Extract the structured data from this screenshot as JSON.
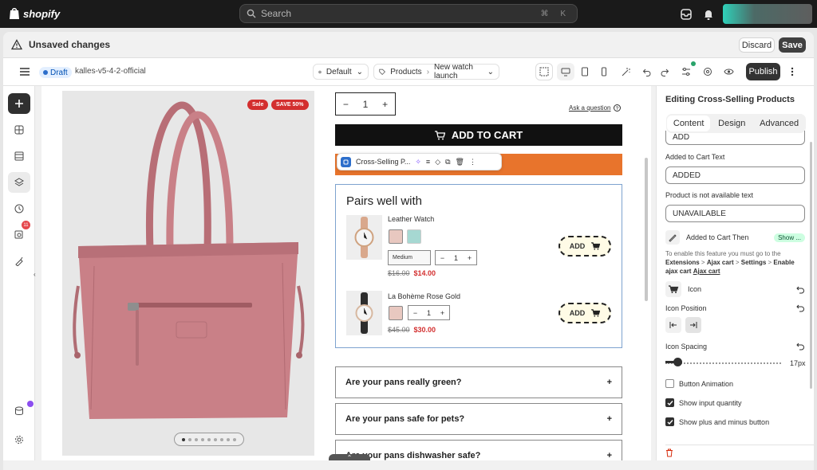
{
  "topbar": {
    "brand": "shopify",
    "search_placeholder": "Search",
    "search_shortcut": "⌘ K"
  },
  "unsaved": {
    "title": "Unsaved changes",
    "discard_label": "Discard",
    "save_label": "Save"
  },
  "toolbar": {
    "status": "Draft",
    "theme_name": "kalles-v5-4-2-official",
    "locale": "Default",
    "template_type": "Products",
    "template_name": "New watch launch",
    "publish_label": "Publish"
  },
  "rail": {
    "notification_count": "11"
  },
  "canvas": {
    "badges": {
      "sale": "Sale",
      "save": "SAVE 50%"
    },
    "slider_dots": 9,
    "active_dot": 0,
    "ask_question": "Ask a question",
    "qty_value": "1",
    "add_to_cart": "ADD TO CART",
    "section_toolbar_label": "Cross-Selling P...",
    "cross_sell": {
      "title": "Pairs well with",
      "products": [
        {
          "name": "Leather Watch",
          "variant": "Medium",
          "qty": "1",
          "price_old": "$16.00",
          "price_new": "$14.00",
          "add_label": "ADD"
        },
        {
          "name": "La Bohème Rose Gold",
          "qty": "1",
          "price_old": "$45.00",
          "price_new": "$30.00",
          "add_label": "ADD"
        }
      ]
    },
    "faqs": [
      "Are your pans really green?",
      "Are your pans safe for pets?",
      "Are your pans dishwasher safe?"
    ]
  },
  "panel": {
    "title": "Editing Cross-Selling Products",
    "tabs": [
      "Content",
      "Design",
      "Advanced"
    ],
    "active_tab": "Content",
    "add_button_text": "ADD",
    "added_label": "Added to Cart Text",
    "added_value": "ADDED",
    "unavailable_label": "Product is not available text",
    "unavailable_value": "UNAVAILABLE",
    "added_then_label": "Added to Cart Then",
    "added_then_value": "Show ...",
    "help_prefix": "To enable this feature you must go to the",
    "help_path_1": "Extensions",
    "help_path_2": "Ajax cart",
    "help_path_3": "Settings",
    "help_path_4": "Enable ajax cart",
    "help_link": "Ajax cart",
    "icon_label": "Icon",
    "icon_position_label": "Icon Position",
    "icon_spacing_label": "Icon Spacing",
    "icon_spacing_value": "17px",
    "icon_spacing_fraction": 0.1,
    "button_animation_label": "Button Animation",
    "button_animation_checked": false,
    "show_qty_label": "Show input quantity",
    "show_qty_checked": true,
    "show_plus_minus_label": "Show plus and minus button",
    "show_plus_minus_checked": true
  },
  "colors": {
    "topbar": "#1a1a1a",
    "accent_orange": "#e8742c",
    "sale_red": "#d32f2f",
    "draft_blue": "#2c6ecb",
    "bag_pink": "#c98087"
  }
}
